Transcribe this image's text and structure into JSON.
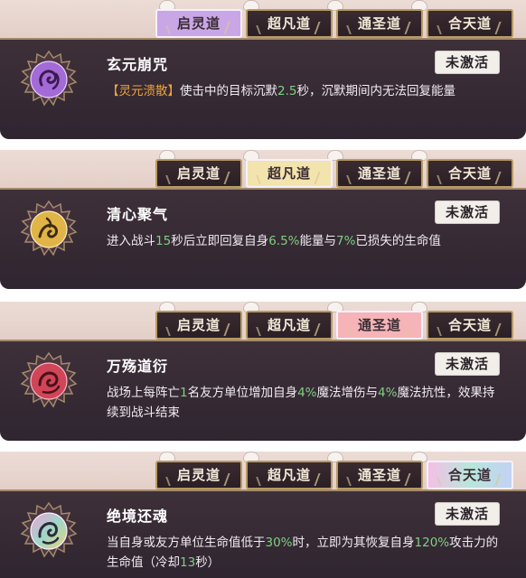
{
  "panels": [
    {
      "tabs": [
        "启灵道",
        "超凡道",
        "通圣道",
        "合天道"
      ],
      "active_tab": 0,
      "active_tab_color": "#c9a6e6",
      "emblem_color": "#a46ad8",
      "emblem_icon": "purple-swirl-emblem-icon",
      "title": "玄元崩咒",
      "status": "未激活",
      "desc": {
        "bracket_open": "【",
        "tag": "灵元溃散",
        "bracket_close": "】",
        "t1": "使击中的目标沉默",
        "v1": "2.5",
        "t2": "秒，沉默期间内无法回复能量"
      }
    },
    {
      "tabs": [
        "启灵道",
        "超凡道",
        "通圣道",
        "合天道"
      ],
      "active_tab": 1,
      "active_tab_color": "#f3e3ad",
      "emblem_color": "#e0b447",
      "emblem_icon": "gold-swirl-emblem-icon",
      "title": "清心聚气",
      "status": "未激活",
      "desc": {
        "t1": "进入战斗",
        "v1": "15",
        "t2": "秒后立即回复自身",
        "v2": "6.5%",
        "t3": "能量与",
        "v3": "7%",
        "t4": "已损失的生命值"
      }
    },
    {
      "tabs": [
        "启灵道",
        "超凡道",
        "通圣道",
        "合天道"
      ],
      "active_tab": 2,
      "active_tab_color": "#f6b4b8",
      "emblem_color": "#d04558",
      "emblem_icon": "red-swirl-emblem-icon",
      "title": "万殇道衍",
      "status": "未激活",
      "desc": {
        "t1": "战场上每阵亡",
        "v1": "1",
        "t2": "名友方单位增加自身",
        "v2": "4%",
        "t3": "魔法增伤与",
        "v3": "4%",
        "t4": "魔法抗性，效果持续到战斗结束"
      }
    },
    {
      "tabs": [
        "启灵道",
        "超凡道",
        "通圣道",
        "合天道"
      ],
      "active_tab": 3,
      "active_tab_color": "#b8e6dc",
      "emblem_color": "#9ed7c8",
      "emblem_icon": "rainbow-swirl-emblem-icon",
      "title": "绝境还魂",
      "status": "未激活",
      "desc": {
        "t1": "当自身或友方单位生命值低于",
        "v1": "30%",
        "t2": "时，立即为其恢复自身",
        "v2": "120%",
        "t3": "攻击力的生命值（冷却",
        "v3": "13",
        "t4": "秒）"
      }
    }
  ]
}
